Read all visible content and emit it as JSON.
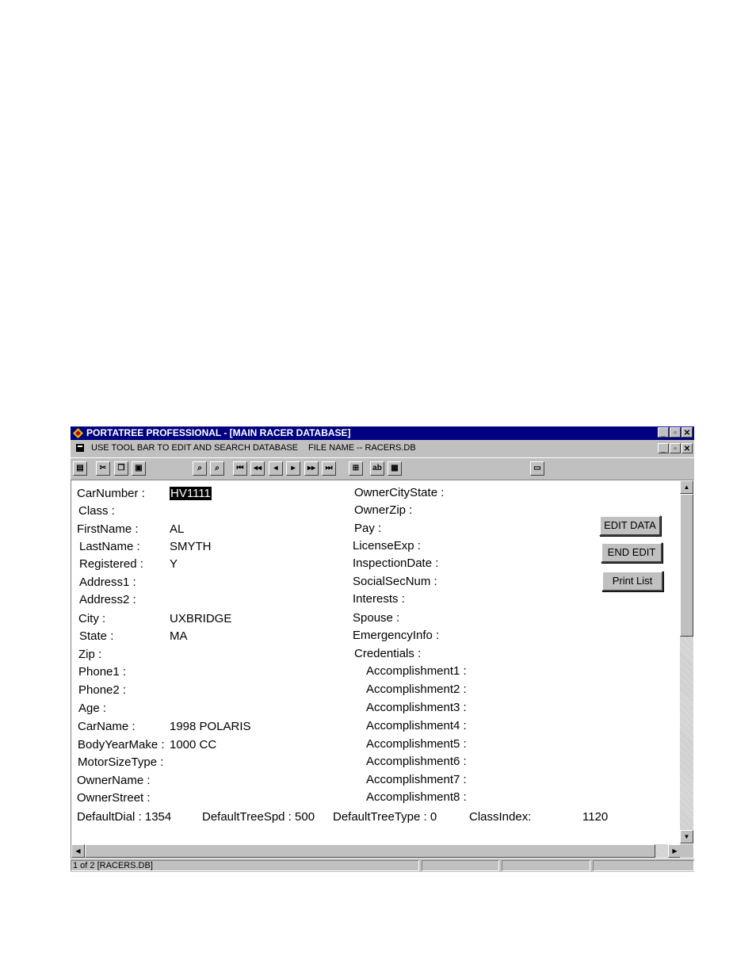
{
  "window": {
    "title": "PORTATREE PROFESSIONAL - [MAIN RACER DATABASE]",
    "controls": {
      "minimize": "_",
      "restore": "▫",
      "close": "✕"
    }
  },
  "menubar": {
    "instruction": "USE TOOL BAR TO EDIT AND SEARCH DATABASE",
    "file_name": "FILE NAME -- RACERS.DB"
  },
  "toolbar": {
    "print": "▤",
    "cut": "✂",
    "copy": "❐",
    "paste": "▣",
    "find": "⌕",
    "find_next": "⌕",
    "first": "⏮",
    "prev_page": "◂◂",
    "prev": "◂",
    "next": "▸",
    "next_page": "▸▸",
    "last": "⏭",
    "zoom": "⊞",
    "abc": "ab",
    "form": "▦",
    "window": "▭"
  },
  "record": {
    "left": [
      {
        "label": "CarNumber :",
        "value": "HV1111"
      },
      {
        "label": "Class :",
        "value": ""
      },
      {
        "label": "FirstName :",
        "value": "AL"
      },
      {
        "label": "LastName :",
        "value": "SMYTH"
      },
      {
        "label": "Registered :",
        "value": "Y"
      },
      {
        "label": "Address1 :",
        "value": ""
      },
      {
        "label": "Address2 :",
        "value": ""
      },
      {
        "label": "City :",
        "value": "UXBRIDGE"
      },
      {
        "label": "State :",
        "value": "MA"
      },
      {
        "label": "Zip :",
        "value": ""
      },
      {
        "label": "Phone1 :",
        "value": ""
      },
      {
        "label": "Phone2 :",
        "value": ""
      },
      {
        "label": "Age :",
        "value": ""
      },
      {
        "label": "CarName :",
        "value": "1998 POLARIS"
      },
      {
        "label": "BodyYearMake :",
        "value": "1000 CC"
      },
      {
        "label": "MotorSizeType :",
        "value": ""
      },
      {
        "label": "OwnerName :",
        "value": ""
      },
      {
        "label": "OwnerStreet :",
        "value": ""
      }
    ],
    "right": [
      {
        "label": "OwnerCityState :"
      },
      {
        "label": "OwnerZip :"
      },
      {
        "label": "Pay :"
      },
      {
        "label": "LicenseExp :"
      },
      {
        "label": "InspectionDate :"
      },
      {
        "label": "SocialSecNum :"
      },
      {
        "label": "Interests :"
      },
      {
        "label": "Spouse :"
      },
      {
        "label": "EmergencyInfo :"
      },
      {
        "label": "Credentials :"
      },
      {
        "label": "Accomplishment1 :"
      },
      {
        "label": "Accomplishment2 :"
      },
      {
        "label": "Accomplishment3 :"
      },
      {
        "label": "Accomplishment4 :"
      },
      {
        "label": "Accomplishment5 :"
      },
      {
        "label": "Accomplishment6 :"
      },
      {
        "label": "Accomplishment7 :"
      },
      {
        "label": "Accomplishment8 :"
      }
    ],
    "bottom": {
      "default_dial": "DefaultDial : 1354",
      "default_tree_spd": "DefaultTreeSpd : 500",
      "default_tree_type": "DefaultTreeType : 0",
      "class_index_label": "ClassIndex:",
      "class_index_value": "1120"
    }
  },
  "buttons": {
    "edit_data": "EDIT DATA",
    "end_edit": "END EDIT",
    "print_list": "Print List"
  },
  "scroll": {
    "up": "▲",
    "down": "▼",
    "left": "◀",
    "right": "▶"
  },
  "status": {
    "record_position": "1 of 2 [RACERS.DB]"
  }
}
